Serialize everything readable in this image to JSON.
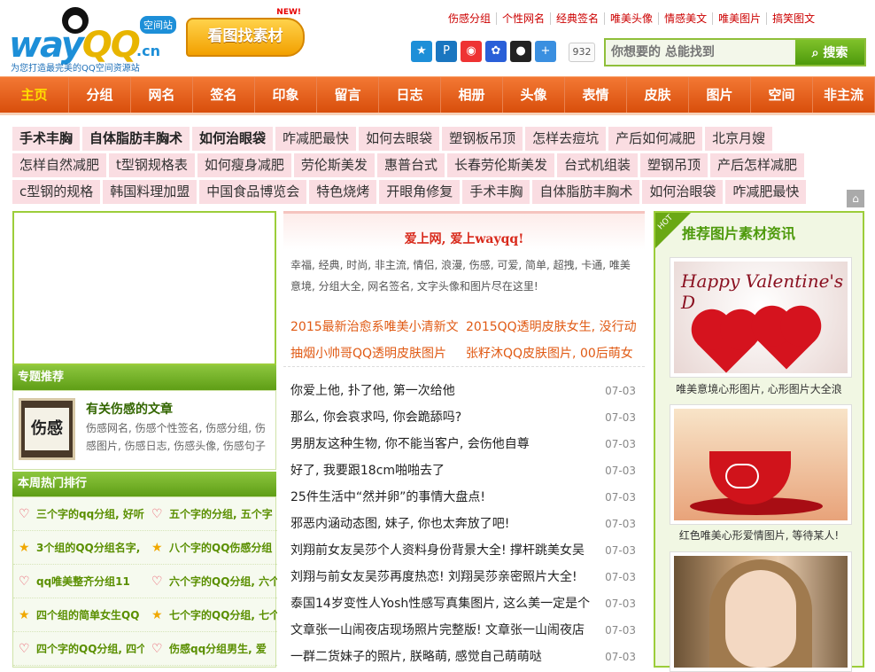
{
  "logo": {
    "word_left": "way",
    "word_mid": "QQ",
    "word_cn": ".cn",
    "badge": "空间站",
    "slogan": "为您打造最完美的QQ空间资源站"
  },
  "find_material": {
    "label": "看图找素材",
    "new_tag": "NEW!"
  },
  "top_links": [
    "伤感分组",
    "个性网名",
    "经典签名",
    "唯美头像",
    "情感美文",
    "唯美图片",
    "搞笑图文"
  ],
  "share": {
    "icons": [
      {
        "name": "qzone-icon",
        "glyph": "★",
        "color": "#1d8fd8"
      },
      {
        "name": "tencent-weibo-icon",
        "glyph": "P",
        "color": "#1a76c0"
      },
      {
        "name": "sina-weibo-icon",
        "glyph": "◉",
        "color": "#e33"
      },
      {
        "name": "baidu-icon",
        "glyph": "✿",
        "color": "#2a5fd8"
      },
      {
        "name": "qq-icon",
        "glyph": "●",
        "color": "#222"
      },
      {
        "name": "more-share-icon",
        "glyph": "+",
        "color": "#3a8fe0"
      }
    ],
    "count": "932"
  },
  "search": {
    "placeholder": "你想要的 总能找到",
    "button": "搜索"
  },
  "nav": [
    "主页",
    "分组",
    "网名",
    "签名",
    "印象",
    "留言",
    "日志",
    "相册",
    "头像",
    "表情",
    "皮肤",
    "图片",
    "空间",
    "非主流"
  ],
  "keywords": [
    [
      {
        "t": "手术丰胸",
        "b": true
      },
      {
        "t": "自体脂肪丰胸术",
        "b": true
      },
      {
        "t": "如何治眼袋",
        "b": true
      },
      {
        "t": "咋减肥最快"
      },
      {
        "t": "如何去眼袋"
      },
      {
        "t": "塑钢板吊顶"
      },
      {
        "t": "怎样去痘坑"
      },
      {
        "t": "产后如何减肥"
      },
      {
        "t": "北京月嫂"
      }
    ],
    [
      {
        "t": "怎样自然减肥"
      },
      {
        "t": "t型钢规格表"
      },
      {
        "t": "如何瘦身减肥"
      },
      {
        "t": "劳伦斯美发"
      },
      {
        "t": "惠普台式"
      },
      {
        "t": "长春劳伦斯美发"
      },
      {
        "t": "台式机组装"
      },
      {
        "t": "塑钢吊顶"
      },
      {
        "t": "产后怎样减肥"
      }
    ],
    [
      {
        "t": "c型钢的规格"
      },
      {
        "t": "韩国料理加盟"
      },
      {
        "t": "中国食品博览会"
      },
      {
        "t": "特色烧烤"
      },
      {
        "t": "开眼角修复"
      },
      {
        "t": "手术丰胸"
      },
      {
        "t": "自体脂肪丰胸术"
      },
      {
        "t": "如何治眼袋"
      },
      {
        "t": "咋减肥最快"
      }
    ]
  ],
  "left": {
    "topic_header": "专题推荐",
    "topic": {
      "thumb": "伤感",
      "title": "有关伤感的文章",
      "desc": "伤感网名, 伤感个性签名, 伤感分组, 伤感图片, 伤感日志, 伤感头像, 伤感句子"
    },
    "hot_header": "本周热门排行",
    "hot": [
      [
        {
          "t": "三个字的qq分组, 好听",
          "i": "♡"
        },
        {
          "t": "五个字的分组, 五个字",
          "i": "♡"
        }
      ],
      [
        {
          "t": "3个组的QQ分组名字,",
          "i": "★"
        },
        {
          "t": "八个字的QQ伤感分组",
          "i": "★"
        }
      ],
      [
        {
          "t": "qq唯美整齐分组11",
          "i": "♡"
        },
        {
          "t": "六个字的QQ分组, 六个",
          "i": "♡"
        }
      ],
      [
        {
          "t": "四个组的简单女生QQ",
          "i": "★"
        },
        {
          "t": "七个字的QQ分组, 七个",
          "i": "★"
        }
      ],
      [
        {
          "t": "四个字的QQ分组, 四个",
          "i": "♡"
        },
        {
          "t": "伤感qq分组男生, 爱",
          "i": "♡"
        }
      ]
    ]
  },
  "mid": {
    "intro_title": "爱上网, 爱上wayqq!",
    "intro_desc": "幸福, 经典, 时尚, 非主流, 情侣, 浪漫, 伤感, 可爱, 简单, 超拽, 卡通, 唯美意境, 分组大全, 网名签名, 文字头像和图片尽在这里!",
    "features": [
      "2015最新治愈系唯美小清新文",
      "2015QQ透明皮肤女生, 没行动",
      "抽烟小帅哥QQ透明皮肤图片",
      "张籽沐QQ皮肤图片, 00后萌女"
    ],
    "news": [
      {
        "t": "你爱上他, 扑了他, 第一次给他",
        "d": "07-03"
      },
      {
        "t": "那么, 你会哀求吗, 你会跪舔吗?",
        "d": "07-03"
      },
      {
        "t": "男朋友这种生物, 你不能当客户, 会伤他自尊",
        "d": "07-03"
      },
      {
        "t": "好了, 我要跟18cm啪啪去了",
        "d": "07-03"
      },
      {
        "t": "25件生活中“然并卵”的事情大盘点!",
        "d": "07-03"
      },
      {
        "t": "邪恶内涵动态图, 妹子, 你也太奔放了吧!",
        "d": "07-03"
      },
      {
        "t": "刘翔前女友吴莎个人资料身份背景大全! 撑杆跳美女吴",
        "d": "07-03"
      },
      {
        "t": "刘翔与前女友吴莎再度热恋! 刘翔吴莎亲密照片大全!",
        "d": "07-03"
      },
      {
        "t": "泰国14岁变性人Yosh性感写真集图片, 这么美一定是个",
        "d": "07-03"
      },
      {
        "t": "文章张一山闹夜店现场照片完整版! 文章张一山闹夜店",
        "d": "07-03"
      },
      {
        "t": "一群二货妹子的照片, 朕略萌, 感觉自己萌萌哒",
        "d": "07-03"
      }
    ]
  },
  "right": {
    "ribbon": "HOT",
    "title": "推荐图片素材资讯",
    "pics": [
      {
        "script": "Happy Valentine's D",
        "cap": "唯美意境心形图片, 心形图片大全浪"
      },
      {
        "cap": "红色唯美心形爱情图片, 等待某人!"
      },
      {
        "cap": ""
      }
    ]
  },
  "colors": {
    "nav": "#e8611e",
    "accent_green": "#7ab82a",
    "link_red": "#c00"
  }
}
